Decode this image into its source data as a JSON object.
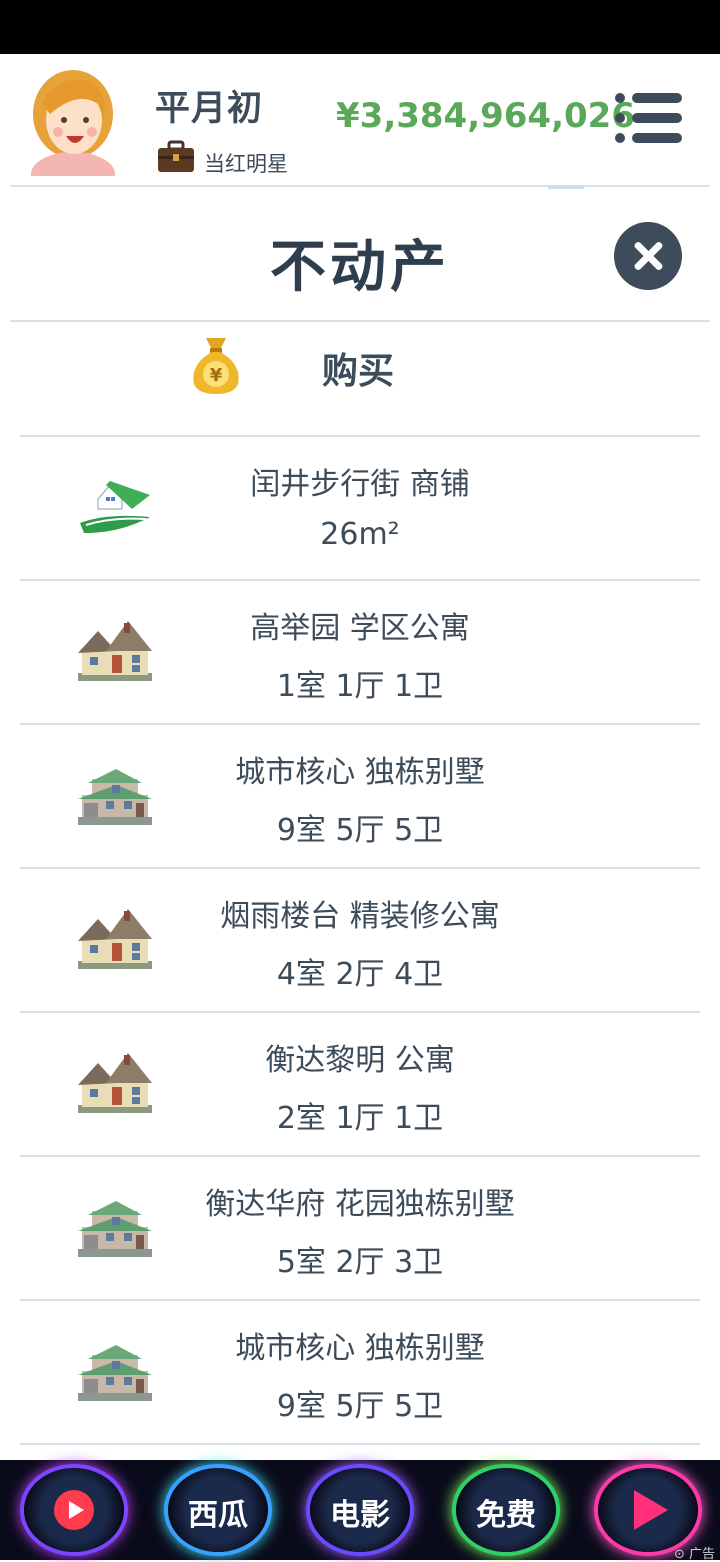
{
  "header": {
    "name": "平月初",
    "title": "当红明星",
    "money": "¥3,384,964,026"
  },
  "panel": {
    "title": "不动产",
    "buy_label": "购买"
  },
  "properties": [
    {
      "name": "闰井步行街 商铺",
      "detail": "26m²",
      "icon": "shop-icon"
    },
    {
      "name": "高举园 学区公寓",
      "detail": "1室 1厅 1卫",
      "icon": "apartment-icon"
    },
    {
      "name": "城市核心 独栋别墅",
      "detail": "9室 5厅 5卫",
      "icon": "villa-icon"
    },
    {
      "name": "烟雨楼台 精装修公寓",
      "detail": "4室 2厅 4卫",
      "icon": "apartment-icon"
    },
    {
      "name": "衡达黎明 公寓",
      "detail": "2室 1厅 1卫",
      "icon": "apartment-icon"
    },
    {
      "name": "衡达华府 花园独栋别墅",
      "detail": "5室 2厅 3卫",
      "icon": "villa-icon"
    },
    {
      "name": "城市核心 独栋别墅",
      "detail": "9室 5厅 5卫",
      "icon": "villa-icon"
    }
  ],
  "adbar": {
    "items": [
      "西瓜",
      "电影",
      "免费"
    ],
    "ad_tag": "广告"
  }
}
